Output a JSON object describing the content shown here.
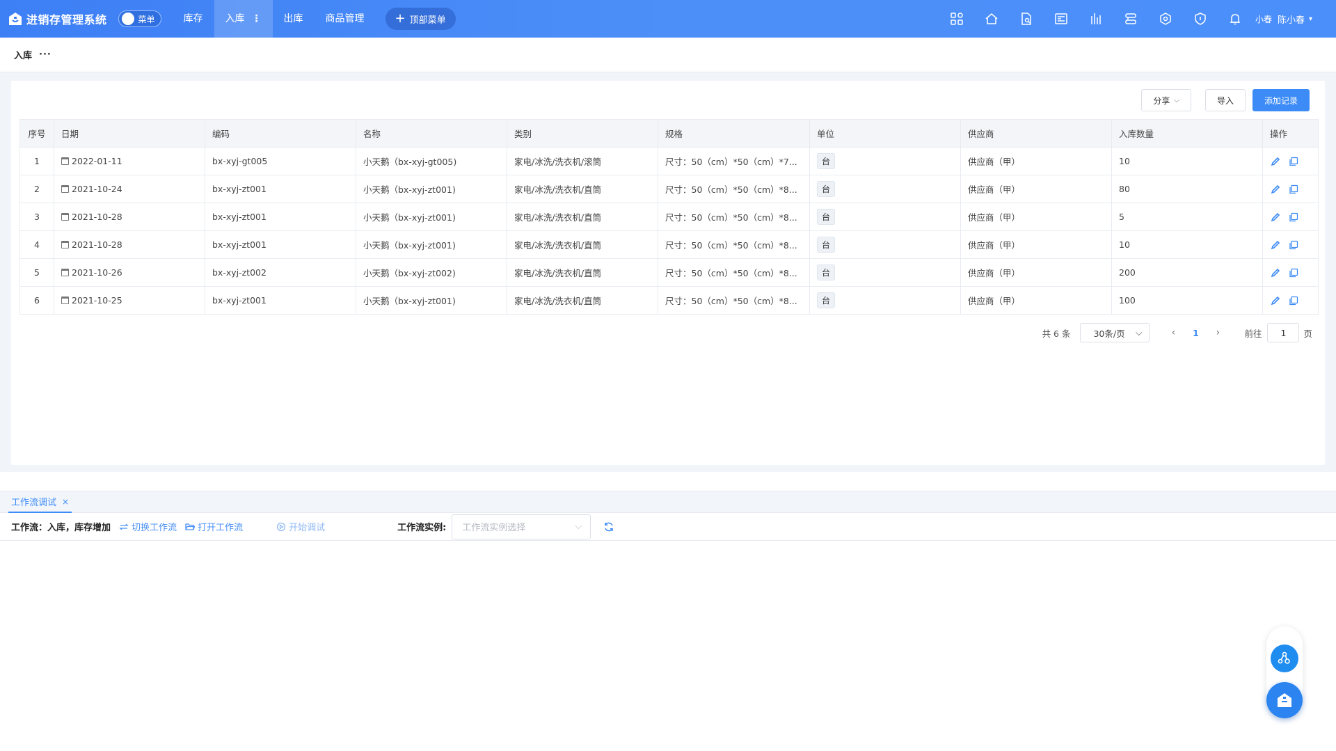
{
  "app": {
    "title": "进销存管理系统",
    "menu_toggle_label": "菜单"
  },
  "nav": {
    "items": [
      {
        "label": "库存"
      },
      {
        "label": "入库"
      },
      {
        "label": "出库"
      },
      {
        "label": "商品管理"
      }
    ],
    "active": "入库",
    "active_more": "⋮",
    "top_menu_label": "顶部菜单"
  },
  "top_icons": [
    "apps-icon",
    "home-icon",
    "document-search-icon",
    "report-icon",
    "chart-icon",
    "storage-icon",
    "network-icon",
    "shield-icon",
    "bell-icon"
  ],
  "user": {
    "nickname": "小春",
    "name": "陈小春"
  },
  "breadcrumb": {
    "current": "入库",
    "more": "···"
  },
  "toolbar": {
    "share_label": "分享",
    "import_label": "导入",
    "add_label": "添加记录"
  },
  "table": {
    "columns": [
      "序号",
      "日期",
      "编码",
      "名称",
      "类别",
      "规格",
      "单位",
      "供应商",
      "入库数量",
      "操作"
    ],
    "rows": [
      {
        "no": "1",
        "date": "2022-01-11",
        "code": "bx-xyj-gt005",
        "name": "小天鹅（bx-xyj-gt005)",
        "category": "家电/冰洗/洗衣机/滚筒",
        "spec": "尺寸：50（cm）*50（cm）*7...",
        "unit": "台",
        "supplier": "供应商（甲）",
        "qty": "10"
      },
      {
        "no": "2",
        "date": "2021-10-24",
        "code": "bx-xyj-zt001",
        "name": "小天鹅（bx-xyj-zt001)",
        "category": "家电/冰洗/洗衣机/直筒",
        "spec": "尺寸：50（cm）*50（cm）*8...",
        "unit": "台",
        "supplier": "供应商（甲）",
        "qty": "80"
      },
      {
        "no": "3",
        "date": "2021-10-28",
        "code": "bx-xyj-zt001",
        "name": "小天鹅（bx-xyj-zt001)",
        "category": "家电/冰洗/洗衣机/直筒",
        "spec": "尺寸：50（cm）*50（cm）*8...",
        "unit": "台",
        "supplier": "供应商（甲）",
        "qty": "5"
      },
      {
        "no": "4",
        "date": "2021-10-28",
        "code": "bx-xyj-zt001",
        "name": "小天鹅（bx-xyj-zt001)",
        "category": "家电/冰洗/洗衣机/直筒",
        "spec": "尺寸：50（cm）*50（cm）*8...",
        "unit": "台",
        "supplier": "供应商（甲）",
        "qty": "10"
      },
      {
        "no": "5",
        "date": "2021-10-26",
        "code": "bx-xyj-zt002",
        "name": "小天鹅（bx-xyj-zt002)",
        "category": "家电/冰洗/洗衣机/直筒",
        "spec": "尺寸：50（cm）*50（cm）*8...",
        "unit": "台",
        "supplier": "供应商（甲）",
        "qty": "200"
      },
      {
        "no": "6",
        "date": "2021-10-25",
        "code": "bx-xyj-zt001",
        "name": "小天鹅（bx-xyj-zt001)",
        "category": "家电/冰洗/洗衣机/直筒",
        "spec": "尺寸：50（cm）*50（cm）*8...",
        "unit": "台",
        "supplier": "供应商（甲）",
        "qty": "100"
      }
    ]
  },
  "pager": {
    "total": "共 6 条",
    "page_size": "30条/页",
    "current_page": "1",
    "goto_label": "前往",
    "goto_value": "1",
    "page_suffix": "页"
  },
  "workflow": {
    "tab_label": "工作流调试",
    "tab_close": "×",
    "label": "工作流：",
    "value": "入库，库存增加",
    "switch_label": "切换工作流",
    "open_label": "打开工作流",
    "start_label": "开始调试",
    "instance_label": "工作流实例:",
    "instance_placeholder": "工作流实例选择"
  },
  "colors": {
    "primary": "#3c8bf6",
    "topbar": "#4b8ffb"
  }
}
